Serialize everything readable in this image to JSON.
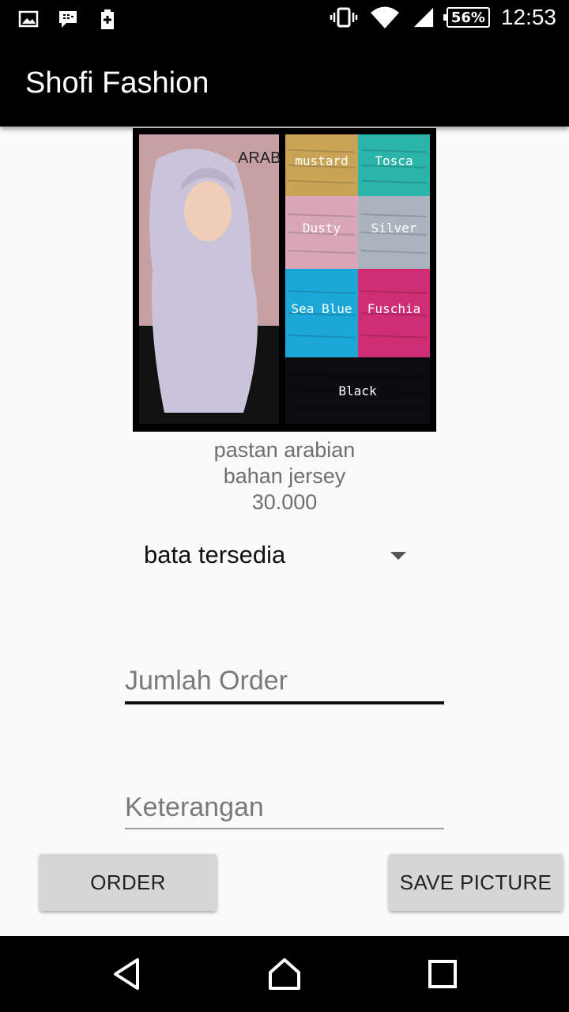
{
  "status_bar": {
    "battery_percent": "56%",
    "time": "12:53",
    "icons": [
      "gallery-icon",
      "bbm-icon",
      "battery-charging-icon",
      "vibrate-icon",
      "wifi-icon",
      "signal-icon"
    ]
  },
  "app_bar": {
    "title": "Shofi Fashion"
  },
  "product": {
    "name": "pastan arabian",
    "material": "bahan jersey",
    "price": "30.000",
    "image": {
      "brand_text": "ARAB",
      "swatches": [
        {
          "label": "mustard",
          "color": "#c9a457"
        },
        {
          "label": "Tosca",
          "color": "#2bb4a9"
        },
        {
          "label": "Dusty",
          "color": "#d8a6b6"
        },
        {
          "label": "Silver",
          "color": "#a9b4bf"
        },
        {
          "label": "Sea Blue",
          "color": "#1ba7d8"
        },
        {
          "label": "Fuschia",
          "color": "#cf2d74"
        },
        {
          "label": "Black",
          "color": "#0c0c10"
        }
      ]
    }
  },
  "form": {
    "color_spinner": {
      "selected": "bata tersedia"
    },
    "quantity_field": {
      "placeholder": "Jumlah Order",
      "value": ""
    },
    "notes_field": {
      "placeholder": "Keterangan",
      "value": ""
    }
  },
  "buttons": {
    "order_label": "ORDER",
    "save_picture_label": "SAVE PICTURE"
  },
  "colors": {
    "app_bar": "#000000",
    "background": "#fafafa",
    "button": "#d6d6d6",
    "focused_underline": "#111111"
  }
}
